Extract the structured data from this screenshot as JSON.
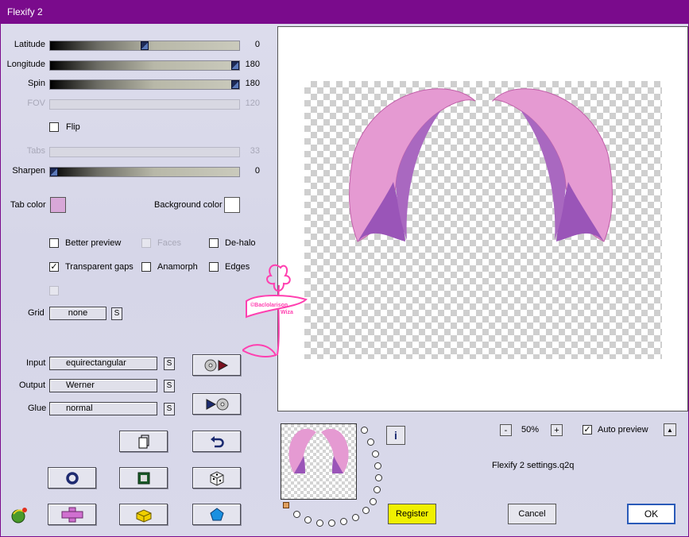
{
  "window": {
    "title": "Flexify 2"
  },
  "sliders": [
    {
      "label": "Latitude",
      "value": "0",
      "level": 0.5,
      "enabled": true
    },
    {
      "label": "Longitude",
      "value": "180",
      "level": 1.0,
      "enabled": true
    },
    {
      "label": "Spin",
      "value": "180",
      "level": 1.0,
      "enabled": true
    },
    {
      "label": "FOV",
      "value": "120",
      "level": 0.5,
      "enabled": false
    },
    {
      "label": "Tabs",
      "value": "33",
      "level": 0.0,
      "enabled": false
    },
    {
      "label": "Sharpen",
      "value": "0",
      "level": 0.0,
      "enabled": true
    }
  ],
  "flip": {
    "label": "Flip",
    "checked": false
  },
  "colors": {
    "tab_label": "Tab color",
    "tab_color": "#d8a8d8",
    "bg_label": "Background color",
    "bg_color": "#ffffff"
  },
  "options": {
    "better_preview": {
      "label": "Better preview",
      "checked": false
    },
    "faces": {
      "label": "Faces",
      "checked": false
    },
    "dehalo": {
      "label": "De-halo",
      "checked": false
    },
    "transparent_gaps": {
      "label": "Transparent gaps",
      "checked": true
    },
    "anamorph": {
      "label": "Anamorph",
      "checked": false
    },
    "edges": {
      "label": "Edges",
      "checked": false
    }
  },
  "grid": {
    "label": "Grid",
    "value": "none",
    "s": "S"
  },
  "projection": {
    "input_label": "Input",
    "input_value": "equirectangular",
    "output_label": "Output",
    "output_value": "Werner",
    "glue_label": "Glue",
    "glue_value": "normal",
    "s": "S"
  },
  "zoom": {
    "minus": "-",
    "value": "50%",
    "plus": "+"
  },
  "auto_preview": {
    "label": "Auto preview",
    "checked": true,
    "arrow": "▲"
  },
  "settings_file": "Flexify 2 settings.q2q",
  "info": "i",
  "buttons": {
    "register": "Register",
    "cancel": "Cancel",
    "ok": "OK"
  },
  "watermark": {
    "line1": "©Baclolarison",
    "line2": "Wiza"
  },
  "accent": {
    "register_bg": "#f0f000",
    "title_bar": "#7a0b8c",
    "hair_pink": "#e59ad2",
    "hair_purple": "#9a55b8"
  }
}
